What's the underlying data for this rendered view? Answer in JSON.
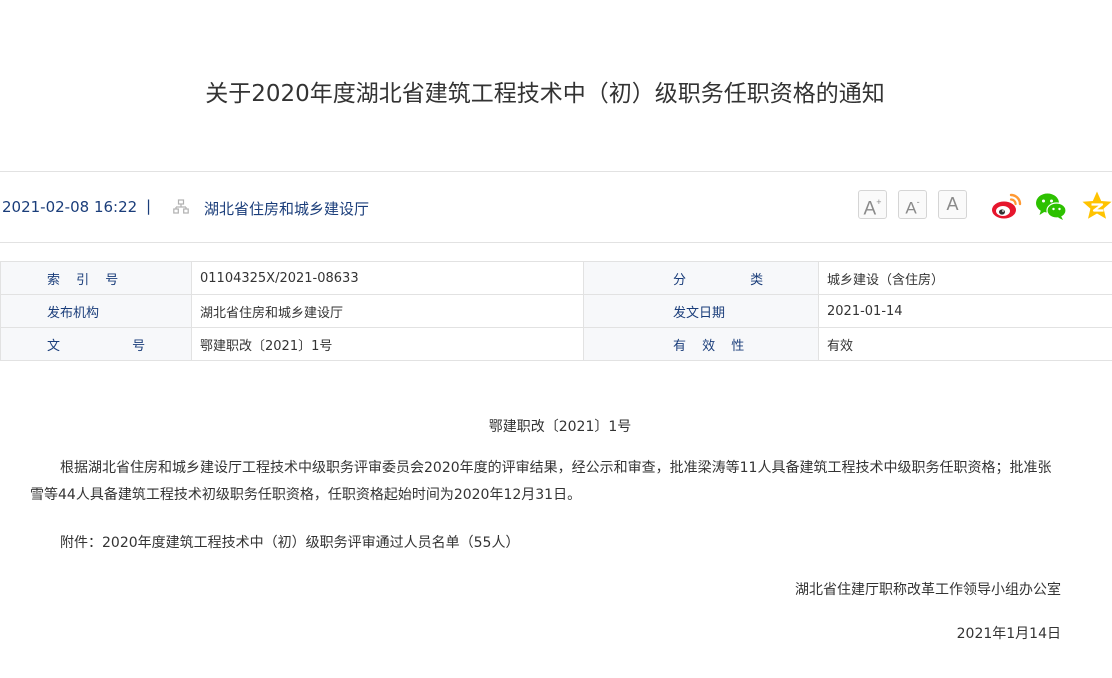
{
  "title": "关于2020年度湖北省建筑工程技术中（初）级职务任职资格的通知",
  "meta": {
    "datetime": "2021-02-08 16:22",
    "separator": "|",
    "organization": "湖北省住房和城乡建设厅",
    "font_sizes": [
      {
        "label": "A",
        "mark": "+"
      },
      {
        "label": "A",
        "mark": "-"
      },
      {
        "label": "A",
        "mark": ""
      }
    ],
    "share_icons": [
      "weibo-icon",
      "wechat-icon",
      "qzone-icon"
    ],
    "colors": {
      "link": "#1a3d7a",
      "weibo": "#e6162d",
      "wechat": "#2dc100",
      "qzone": "#ffc300"
    }
  },
  "info_table": {
    "rows": [
      [
        {
          "key": "索 引 号",
          "value": "01104325X/2021-08633"
        },
        {
          "key": "分 类",
          "value": "城乡建设（含住房）"
        }
      ],
      [
        {
          "key": "发布机构",
          "value": "湖北省住房和城乡建设厅"
        },
        {
          "key": "发文日期",
          "value": "2021-01-14"
        }
      ],
      [
        {
          "key": "文 号",
          "value": "鄂建职改〔2021〕1号"
        },
        {
          "key": "有 效 性",
          "value": "有效"
        }
      ]
    ]
  },
  "body": {
    "doc_number": "鄂建职改〔2021〕1号",
    "paragraph_1": "根据湖北省住房和城乡建设厅工程技术中级职务评审委员会2020年度的评审结果，经公示和审查，批准梁涛等11人具备建筑工程技术中级职务任职资格；批准张雪等44人具备建筑工程技术初级职务任职资格，任职资格起始时间为2020年12月31日。",
    "attachment": "附件：2020年度建筑工程技术中（初）级职务评审通过人员名单（55人）",
    "signature": "湖北省住建厅职称改革工作领导小组办公室",
    "date": "2021年1月14日"
  }
}
